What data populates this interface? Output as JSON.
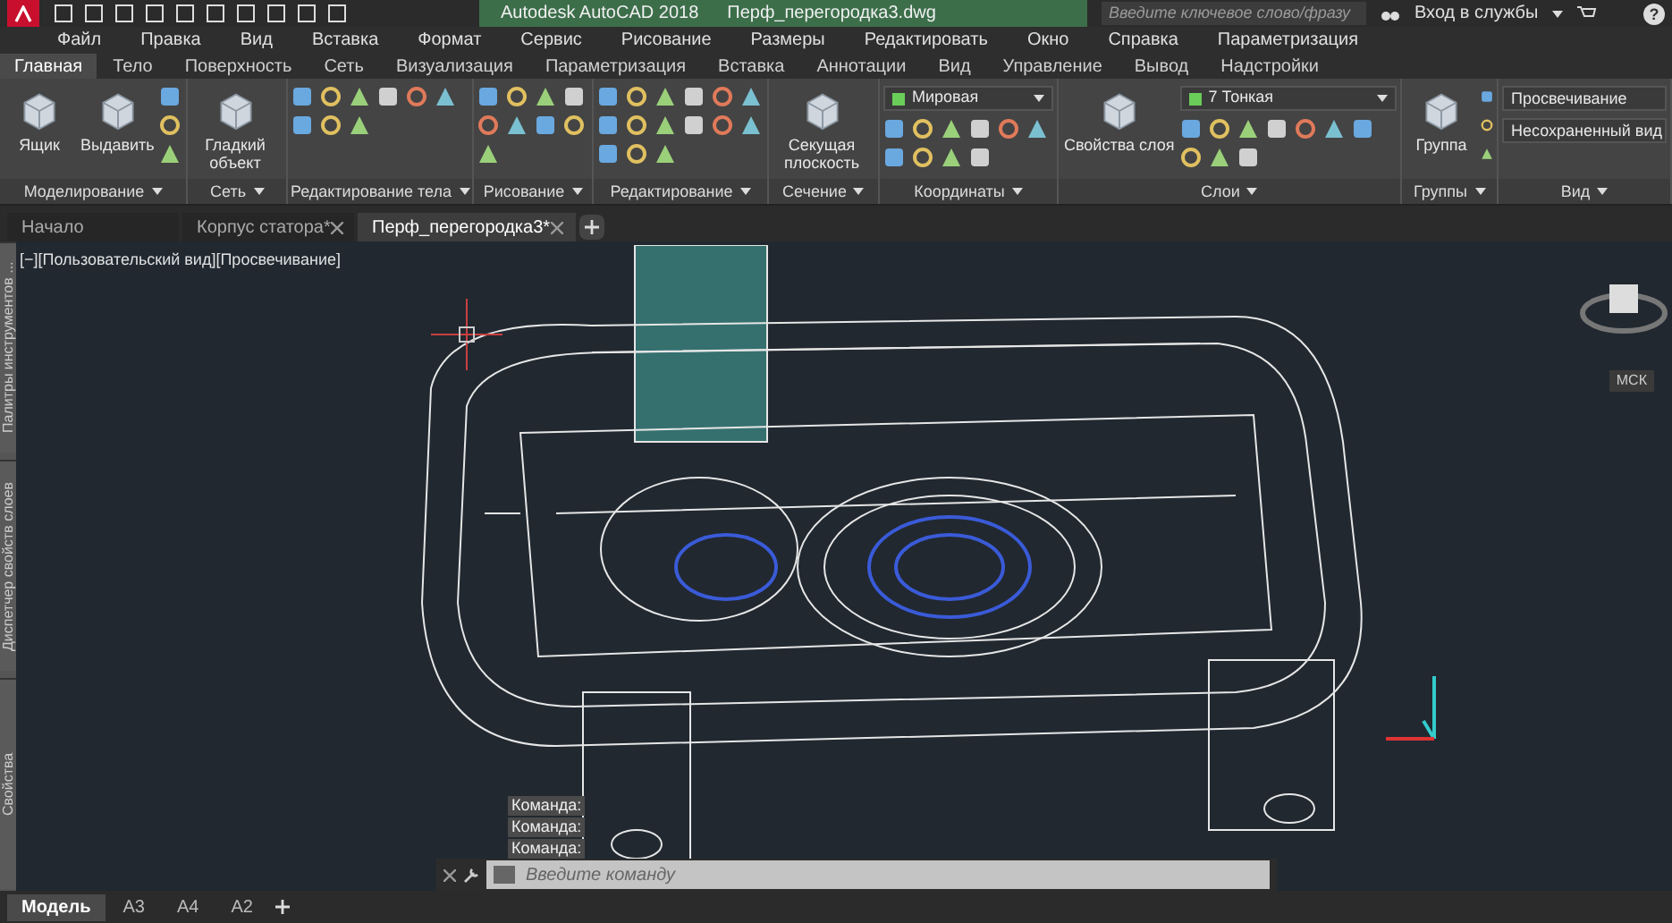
{
  "app_title": "Autodesk AutoCAD 2018",
  "file_title": "Перф_перегородка3.dwg",
  "search": {
    "placeholder": "Введите ключевое слово/фразу"
  },
  "sign_in": "Вход в службы",
  "help": "?",
  "menu": [
    "Файл",
    "Правка",
    "Вид",
    "Вставка",
    "Формат",
    "Сервис",
    "Рисование",
    "Размеры",
    "Редактировать",
    "Окно",
    "Справка",
    "Параметризация"
  ],
  "ribbon_tabs": [
    {
      "label": "Главная",
      "selected": true
    },
    {
      "label": "Тело",
      "selected": false
    },
    {
      "label": "Поверхность",
      "selected": false
    },
    {
      "label": "Сеть",
      "selected": false
    },
    {
      "label": "Визуализация",
      "selected": false
    },
    {
      "label": "Параметризация",
      "selected": false
    },
    {
      "label": "Вставка",
      "selected": false
    },
    {
      "label": "Аннотации",
      "selected": false
    },
    {
      "label": "Вид",
      "selected": false
    },
    {
      "label": "Управление",
      "selected": false
    },
    {
      "label": "Вывод",
      "selected": false
    },
    {
      "label": "Надстройки",
      "selected": false
    }
  ],
  "panels": [
    {
      "title": "Моделирование",
      "buttons": [
        "Ящик",
        "Выдавить"
      ]
    },
    {
      "title": "Сеть",
      "buttons": [
        "Гладкий объект"
      ]
    },
    {
      "title": "Редактирование тела"
    },
    {
      "title": "Рисование"
    },
    {
      "title": "Редактирование"
    },
    {
      "title": "Сечение",
      "buttons": [
        "Секущая плоскость"
      ]
    },
    {
      "title": "Координаты",
      "dropdown": "Мировая"
    },
    {
      "title": "Слои",
      "buttons": [
        "Свойства слоя"
      ],
      "dropdown": "7 Тонкая"
    },
    {
      "title": "Группы",
      "buttons": [
        "Группа"
      ]
    },
    {
      "title": "Вид",
      "view_rows": [
        "Просвечивание",
        "Несохраненный вид"
      ]
    }
  ],
  "doc_tabs": [
    {
      "label": "Начало",
      "selected": false,
      "closable": false
    },
    {
      "label": "Корпус статора*",
      "selected": false,
      "closable": true
    },
    {
      "label": "Перф_перегородка3*",
      "selected": true,
      "closable": true
    }
  ],
  "viewport_label": "[−][Пользовательский вид][Просвечивание]",
  "side_palettes": [
    "Палитры инструментов ...",
    "Диспетчер свойств слоев",
    "Свойства"
  ],
  "ucs_label": "МСК",
  "command_history": [
    "Команда:",
    "Команда:",
    "Команда:"
  ],
  "command": {
    "placeholder": "Введите команду"
  },
  "layout_tabs": [
    {
      "label": "Модель",
      "selected": true
    },
    {
      "label": "А3",
      "selected": false
    },
    {
      "label": "А4",
      "selected": false
    },
    {
      "label": "А2",
      "selected": false
    }
  ]
}
